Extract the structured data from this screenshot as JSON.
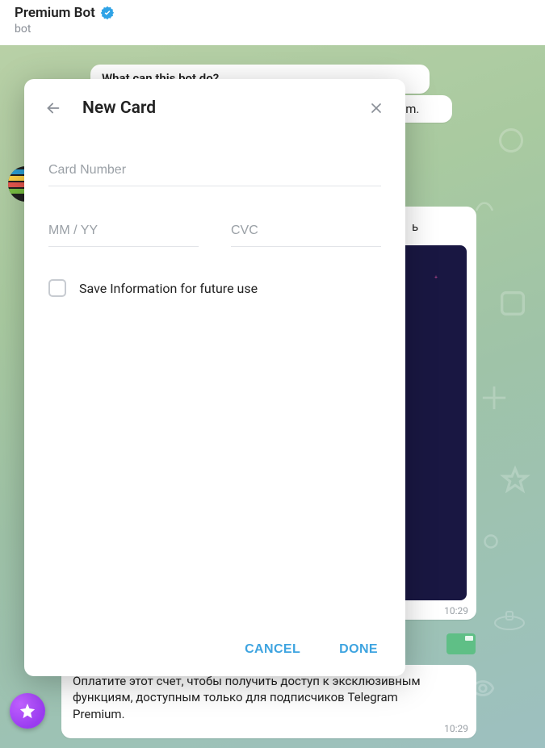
{
  "header": {
    "title": "Premium Bot",
    "subtitle": "bot"
  },
  "messages": {
    "intro": "What can this bot do?",
    "suffix_um": "um.",
    "partial_t": "ь",
    "time1": "10:29",
    "desc": "Оплатите этот счет, чтобы получить доступ к эксклюзивным функциям, доступным только для подписчиков Telegram Premium.",
    "time2": "10:29",
    "time3": "10:29"
  },
  "modal": {
    "title": "New Card",
    "card_number_ph": "Card Number",
    "expiry_ph": "MM / YY",
    "cvc_ph": "CVC",
    "save_label": "Save Information for future use",
    "cancel": "CANCEL",
    "done": "DONE"
  }
}
